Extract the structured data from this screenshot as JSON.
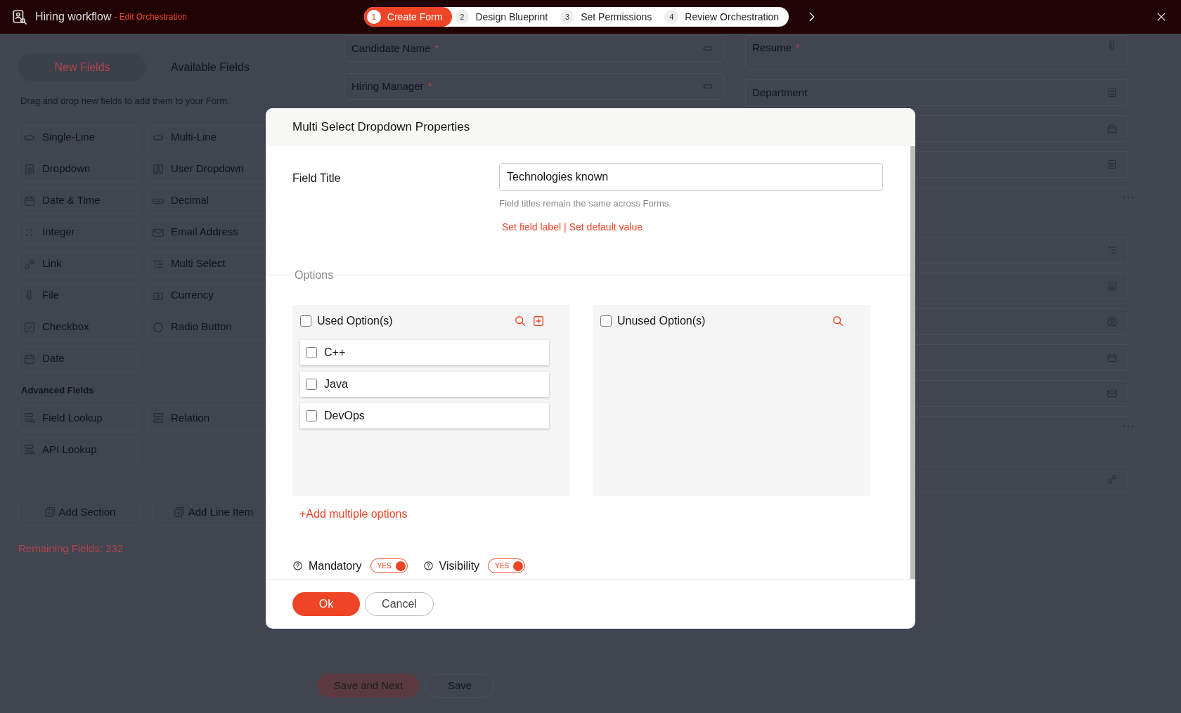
{
  "app_bar": {
    "title": "Hiring workflow",
    "subtitle": "- Edit Orchestration",
    "steps": [
      {
        "number": "1",
        "label": "Create Form",
        "selected": true
      },
      {
        "number": "2",
        "label": "Design Blueprint",
        "selected": false
      },
      {
        "number": "3",
        "label": "Set Permissions",
        "selected": false
      },
      {
        "number": "4",
        "label": "Review Orchestration",
        "selected": false
      }
    ]
  },
  "sidebar": {
    "tabs": [
      {
        "label": "New Fields",
        "selected": true
      },
      {
        "label": "Available Fields",
        "selected": false
      }
    ],
    "hint": "Drag and drop new fields to add them to your Form.",
    "fields": [
      "Single-Line",
      "Multi-Line",
      "Dropdown",
      "User Dropdown",
      "Date & Time",
      "Decimal",
      "Integer",
      "Email Address",
      "Link",
      "Multi Select",
      "File",
      "Currency",
      "Checkbox",
      "Radio Button",
      "Date"
    ],
    "advanced_heading": "Advanced Fields",
    "advanced_fields": [
      "Field Lookup",
      "Relation",
      "API Lookup"
    ],
    "actions": [
      "Add Section",
      "Add Line Item"
    ],
    "remaining": "Remaining Fields: 232"
  },
  "form": {
    "left_fields": [
      {
        "label": "Candidate Name",
        "required_mark": "*"
      },
      {
        "label": "Hiring Manager",
        "required_mark": "*"
      }
    ],
    "right_items": [
      {
        "kind": "field",
        "label": "Resume",
        "required_mark": "*"
      },
      {
        "kind": "field",
        "label": "Department"
      },
      {
        "kind": "field"
      },
      {
        "kind": "field"
      },
      {
        "kind": "section"
      },
      {
        "kind": "field"
      },
      {
        "kind": "field"
      },
      {
        "kind": "field"
      },
      {
        "kind": "field"
      },
      {
        "kind": "field"
      },
      {
        "kind": "section"
      },
      {
        "kind": "field"
      }
    ],
    "buttons": [
      {
        "label": "Save and Next",
        "kind": "primary"
      },
      {
        "label": "Save",
        "kind": "secondary"
      }
    ]
  },
  "dialog": {
    "title": "Multi Select Dropdown Properties",
    "field_title": {
      "label": "Field Title",
      "value": "Technologies known",
      "hint": "Field titles remain the same across Forms.",
      "links": [
        "Set field label",
        "Set default value"
      ],
      "separator": "|"
    },
    "options_legend": "Options",
    "used": {
      "label": "Used Option(s)",
      "checked": false,
      "items": [
        {
          "label": "C++",
          "checked": false
        },
        {
          "label": "Java",
          "checked": false
        },
        {
          "label": "DevOps",
          "checked": false
        }
      ]
    },
    "unused": {
      "label": "Unused Option(s)",
      "checked": false
    },
    "add_multiple": "+Add multiple options",
    "toggles": [
      {
        "label": "Mandatory",
        "on": true,
        "text": "YES"
      },
      {
        "label": "Visibility",
        "on": true,
        "text": "YES"
      }
    ],
    "buttons": [
      {
        "label": "Ok",
        "kind": "primary"
      },
      {
        "label": "Cancel",
        "kind": "secondary"
      }
    ]
  }
}
